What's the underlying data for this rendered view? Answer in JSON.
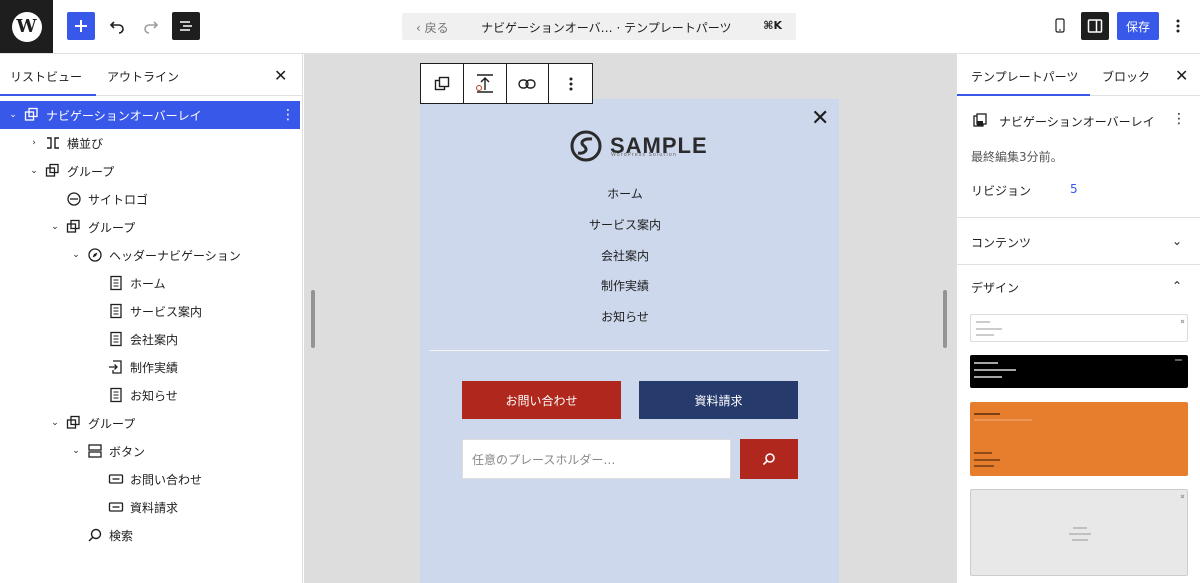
{
  "topbar": {
    "cmd_back": "‹ 戻る",
    "cmd_title": "ナビゲーションオーバ…  · テンプレートパーツ",
    "cmd_shortcut": "⌘K",
    "save_label": "保存"
  },
  "left_panel": {
    "tab_list": "リストビュー",
    "tab_outline": "アウトライン",
    "tree": [
      {
        "label": "ナビゲーションオーバーレイ",
        "icon": "template-part-icon",
        "selected": true
      },
      {
        "label": "横並び",
        "icon": "row-icon"
      },
      {
        "label": "グループ",
        "icon": "group-icon"
      },
      {
        "label": "サイトロゴ",
        "icon": "site-logo-icon"
      },
      {
        "label": "グループ",
        "icon": "group-icon"
      },
      {
        "label": "ヘッダーナビゲーション",
        "icon": "navigation-icon"
      },
      {
        "label": "ホーム",
        "icon": "page-icon"
      },
      {
        "label": "サービス案内",
        "icon": "page-icon"
      },
      {
        "label": "会社案内",
        "icon": "page-icon"
      },
      {
        "label": "制作実績",
        "icon": "custom-link-icon"
      },
      {
        "label": "お知らせ",
        "icon": "page-icon"
      },
      {
        "label": "グループ",
        "icon": "group-icon"
      },
      {
        "label": "ボタン",
        "icon": "buttons-icon"
      },
      {
        "label": "お問い合わせ",
        "icon": "button-icon"
      },
      {
        "label": "資料請求",
        "icon": "button-icon"
      },
      {
        "label": "検索",
        "icon": "search-icon"
      }
    ]
  },
  "canvas": {
    "logo_word": "SAMPLE",
    "logo_tagline": "WordPress Solution",
    "nav": [
      "ホーム",
      "サービス案内",
      "会社案内",
      "制作実績",
      "お知らせ"
    ],
    "button_contact": "お問い合わせ",
    "button_document": "資料請求",
    "search_placeholder": "任意のプレースホルダー…"
  },
  "right_panel": {
    "tab_template": "テンプレートパーツ",
    "tab_block": "ブロック",
    "part_name": "ナビゲーションオーバーレイ",
    "last_edited": "最終編集3分前。",
    "revisions_label": "リビジョン",
    "revisions_count": "5",
    "section_content": "コンテンツ",
    "section_design": "デザイン"
  },
  "colors": {
    "accent": "#3858e9",
    "overlay_bg": "#cdd8ec",
    "contact_red": "#b0271d",
    "document_navy": "#263a6c",
    "design_orange": "#e67e2e"
  }
}
